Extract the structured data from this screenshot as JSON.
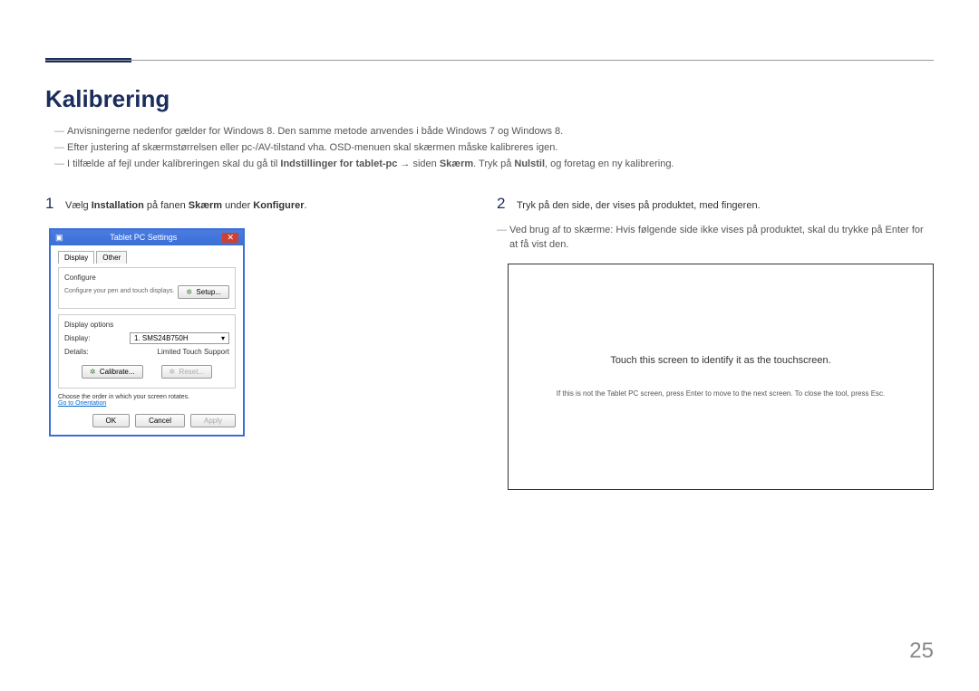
{
  "title": "Kalibrering",
  "notes": [
    "Anvisningerne nedenfor gælder for Windows 8. Den samme metode anvendes i både Windows 7 og Windows 8.",
    "Efter justering af skærmstørrelsen eller pc-/AV-tilstand vha. OSD-menuen skal skærmen måske kalibreres igen."
  ],
  "note3_pre": "I tilfælde af fejl under kalibreringen skal du gå til ",
  "note3_b1": "Indstillinger for tablet-pc",
  "note3_arrow": " → ",
  "note3_mid": "siden ",
  "note3_b2": "Skærm",
  "note3_mid2": ". Tryk på ",
  "note3_b3": "Nulstil",
  "note3_post": ", og foretag en ny kalibrering.",
  "step1": {
    "num": "1",
    "pre": "Vælg ",
    "b1": "Installation",
    "mid1": " på fanen ",
    "b2": "Skærm",
    "mid2": " under ",
    "b3": "Konfigurer",
    "post": "."
  },
  "step2": {
    "num": "2",
    "text": "Tryk på den side, der vises på produktet, med fingeren."
  },
  "step2_note": "Ved brug af to skærme: Hvis følgende side ikke vises på produktet, skal du trykke på Enter for at få vist den.",
  "dialog": {
    "title": "Tablet PC Settings",
    "tabs": [
      "Display",
      "Other"
    ],
    "configure": "Configure",
    "configure_desc": "Configure your pen and touch displays.",
    "setup_btn": "Setup...",
    "display_options": "Display options",
    "display_label": "Display:",
    "display_value": "1. SMS24B750H",
    "details_label": "Details:",
    "details_value": "Limited Touch Support",
    "calibrate_btn": "Calibrate...",
    "reset_btn": "Reset...",
    "rotate_text": "Choose the order in which your screen rotates.",
    "orientation_link": "Go to Orientation",
    "ok": "OK",
    "cancel": "Cancel",
    "apply": "Apply"
  },
  "touch": {
    "main": "Touch this screen to identify it as the touchscreen.",
    "sub": "If this is not the Tablet PC screen, press Enter to move to the next screen. To close the tool, press Esc."
  },
  "page_num": "25"
}
